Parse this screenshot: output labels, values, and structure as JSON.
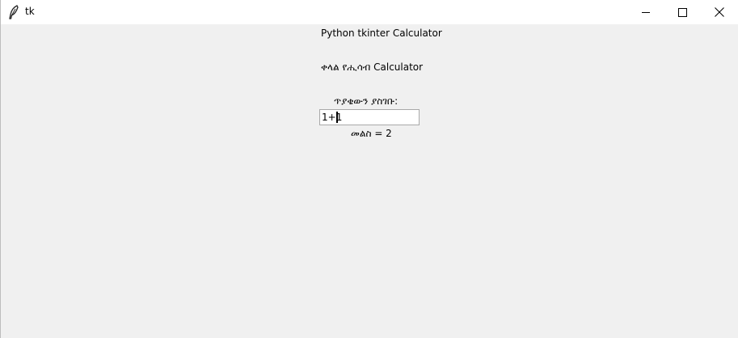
{
  "window": {
    "title": "tk",
    "icon": "feather-icon"
  },
  "controls": {
    "minimize_icon": "minimize-icon",
    "maximize_icon": "maximize-icon",
    "close_icon": "close-icon"
  },
  "content": {
    "title": "Python tkinter Calculator",
    "subtitle": "ቀላል የሒሳብ Calculator",
    "prompt": "ጥያቄውን ያስገቡ:",
    "expression_value": "1+1",
    "result": "መልስ = 2"
  },
  "colors": {
    "background": "#f0f0f0",
    "titlebar": "#ffffff"
  }
}
